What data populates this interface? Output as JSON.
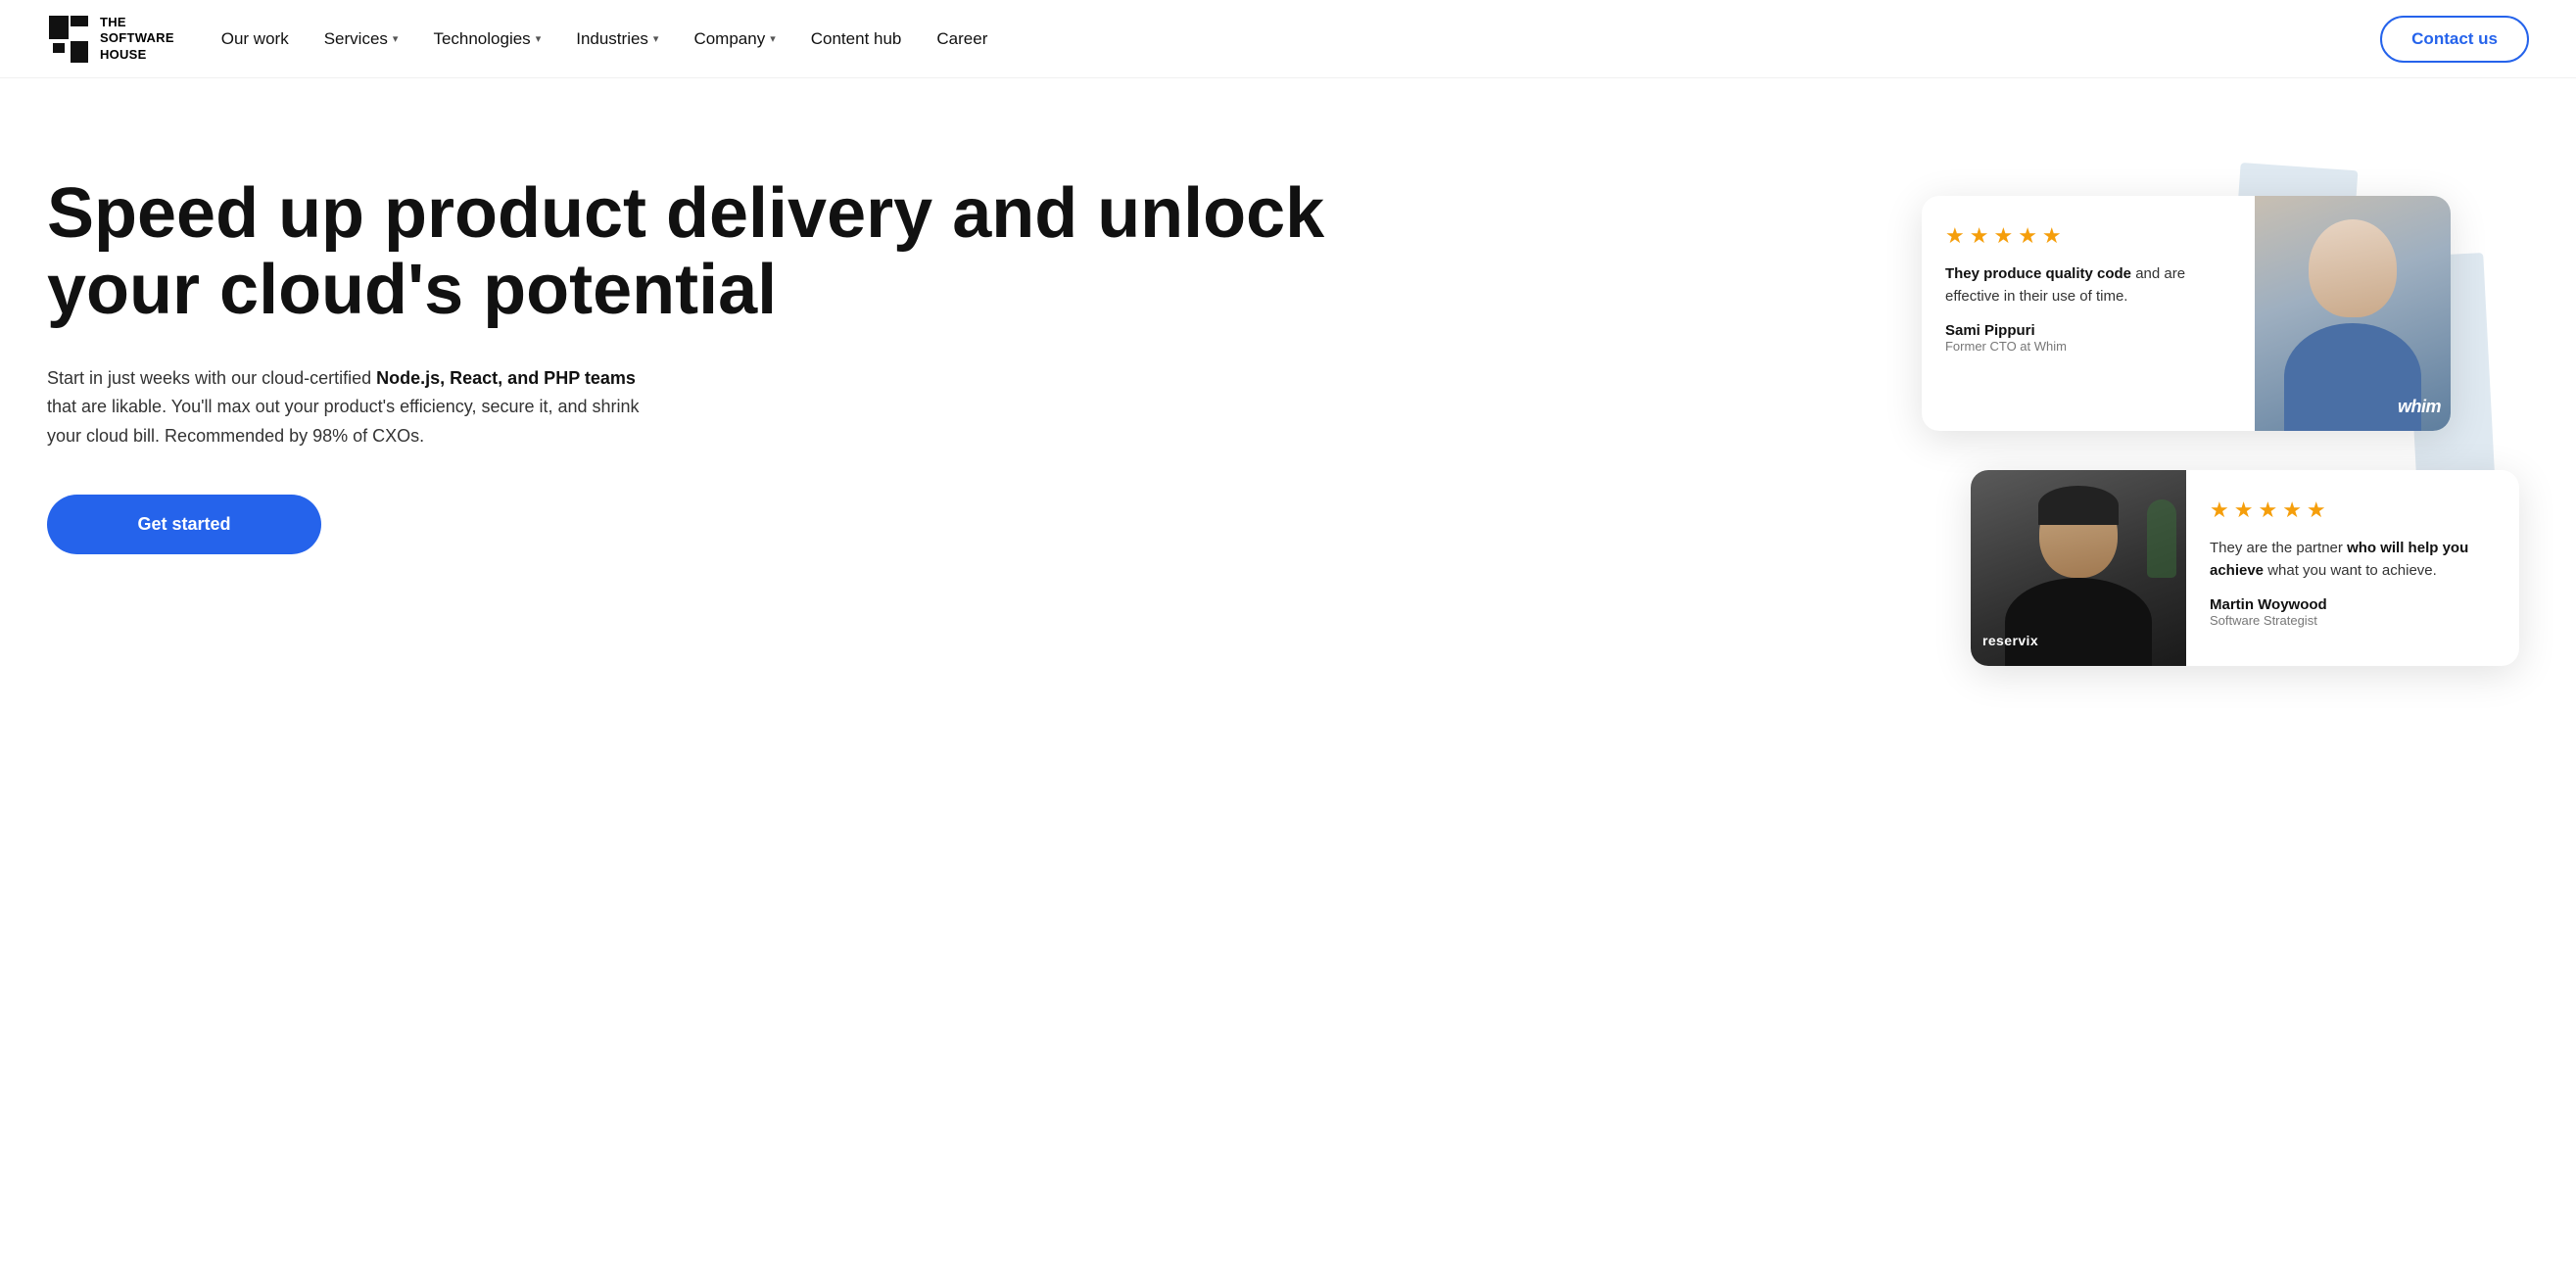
{
  "nav": {
    "logo_line1": "THE",
    "logo_line2": "SOFTWARE",
    "logo_line3": "HOUSE",
    "links": [
      {
        "label": "Our work",
        "has_dropdown": false
      },
      {
        "label": "Services",
        "has_dropdown": true
      },
      {
        "label": "Technologies",
        "has_dropdown": true
      },
      {
        "label": "Industries",
        "has_dropdown": true
      },
      {
        "label": "Company",
        "has_dropdown": true
      },
      {
        "label": "Content hub",
        "has_dropdown": false
      },
      {
        "label": "Career",
        "has_dropdown": false
      }
    ],
    "cta_label": "Contact us"
  },
  "hero": {
    "heading": "Speed up product delivery and unlock your cloud's potential",
    "sub_text_prefix": "Start in just weeks with our cloud-certified ",
    "sub_text_bold": "Node.js, React, and PHP teams",
    "sub_text_suffix": " that are likable. You'll max out your product's efficiency, secure it, and shrink your cloud bill. Recommended by 98% of CXOs.",
    "cta_label": "Get started"
  },
  "testimonials": {
    "card1": {
      "stars": 5,
      "quote_bold": "They produce quality code",
      "quote_suffix": " and are effective in their use of time.",
      "author_name": "Sami Pippuri",
      "author_title": "Former CTO at Whim",
      "company": "whim"
    },
    "card2": {
      "stars": 5,
      "quote_prefix": "They are the partner ",
      "quote_bold": "who will help you achieve",
      "quote_suffix": " what you want to achieve.",
      "author_name": "Martin Woywood",
      "author_title": "Software Strategist",
      "company": "reservix"
    }
  },
  "colors": {
    "accent": "#2563eb",
    "star": "#f59e0b",
    "text_primary": "#111111",
    "text_secondary": "#333333",
    "text_muted": "#777777"
  }
}
